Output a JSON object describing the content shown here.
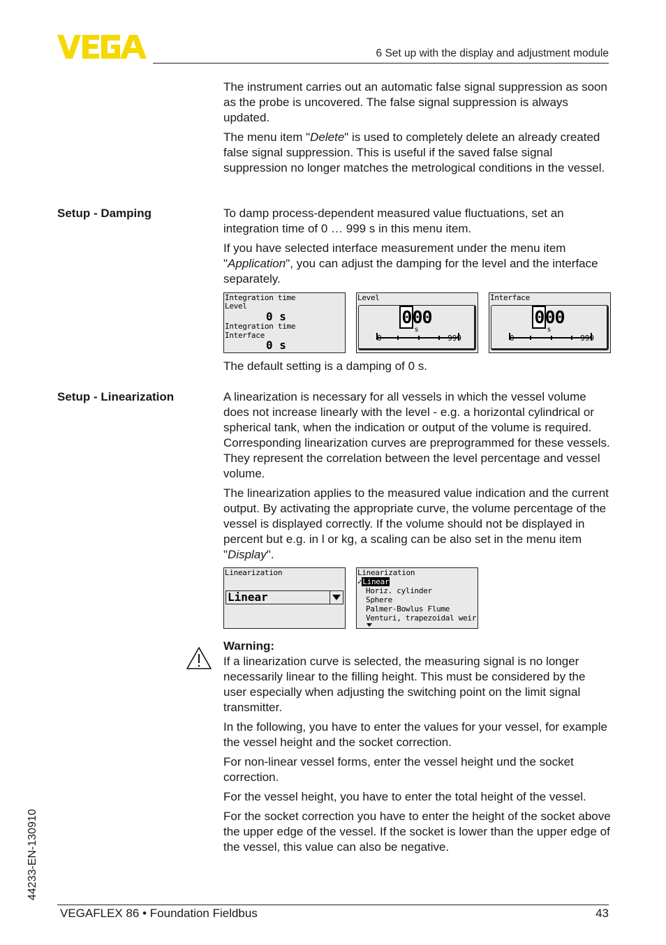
{
  "header": {
    "logo_text": "VEGA",
    "logo_color": "#F5D800",
    "section_title": "6 Set up with the display and adjustment module"
  },
  "intro": {
    "p1": "The instrument carries out an automatic false signal suppression as soon as the probe is uncovered. The false signal suppression is always updated.",
    "p2_before": "The menu item \"",
    "p2_italic": "Delete",
    "p2_after": "\" is used to completely delete an already created false signal suppression. This is useful if the saved false signal suppression no longer matches the metrological conditions in the vessel."
  },
  "damping": {
    "label": "Setup - Damping",
    "p1": "To damp process-dependent measured value fluctuations, set an integration time of 0 … 999 s in this menu item.",
    "p2_before": "If you have selected interface measurement under the menu item \"",
    "p2_italic": "Application",
    "p2_after": "\", you can adjust the damping for the level and the interface separately.",
    "screen1": {
      "line1": "Integration time",
      "line2": "Level",
      "value1": "0 s",
      "line3": "Integration time",
      "line4": "Interface",
      "value2": "0 s"
    },
    "screen2": {
      "title": "Level",
      "digit_cursor": "0",
      "digits_rest": "00",
      "unit": "s",
      "min": "0",
      "max": "999"
    },
    "screen3": {
      "title": "Interface",
      "digit_cursor": "0",
      "digits_rest": "00",
      "unit": "s",
      "min": "0",
      "max": "999"
    },
    "default_note": "The default setting is a damping of 0 s."
  },
  "linearization": {
    "label": "Setup - Linearization",
    "p1": "A linearization is necessary for all vessels in which the vessel volume does not increase linearly with the level - e.g. a horizontal cylindrical or spherical tank, when the indication or output of the volume is required. Corresponding linearization curves are preprogrammed for these vessels. They represent the correlation between the level percentage and vessel volume.",
    "p2_before": "The linearization applies to the measured value indication and the current output. By activating the appropriate curve, the volume percentage of the vessel is displayed correctly. If the volume should not be displayed in percent but e.g. in l or kg, a scaling can be also set in the menu item \"",
    "p2_italic": "Display",
    "p2_after": "\".",
    "screen1": {
      "title": "Linearization",
      "selected": "Linear"
    },
    "screen2": {
      "title": "Linearization",
      "check": "✓",
      "options": [
        "Linear",
        "Horiz. cylinder",
        "Sphere",
        "Palmer-Bowlus Flume",
        "Venturi, trapezoidal weir"
      ]
    },
    "warning": {
      "title": "Warning:",
      "text": "If a linearization curve is selected, the measuring signal is no longer necessarily linear to the filling height. This must be considered by the user especially when adjusting the switching point on the limit signal transmitter."
    },
    "p3": "In the following, you have to enter the values for your vessel, for example the vessel height and the socket correction.",
    "p4": "For non-linear vessel forms, enter the vessel height und the socket correction.",
    "p5": "For the vessel height, you have to enter the total height of the vessel.",
    "p6": "For the socket correction you have to enter the height of the socket above the upper edge of the vessel. If the socket is lower than the upper edge of the vessel, this value can also be negative."
  },
  "sidebar": {
    "doc_id": "44233-EN-130910"
  },
  "footer": {
    "product": "VEGAFLEX 86 • Foundation Fieldbus",
    "page": "43"
  }
}
